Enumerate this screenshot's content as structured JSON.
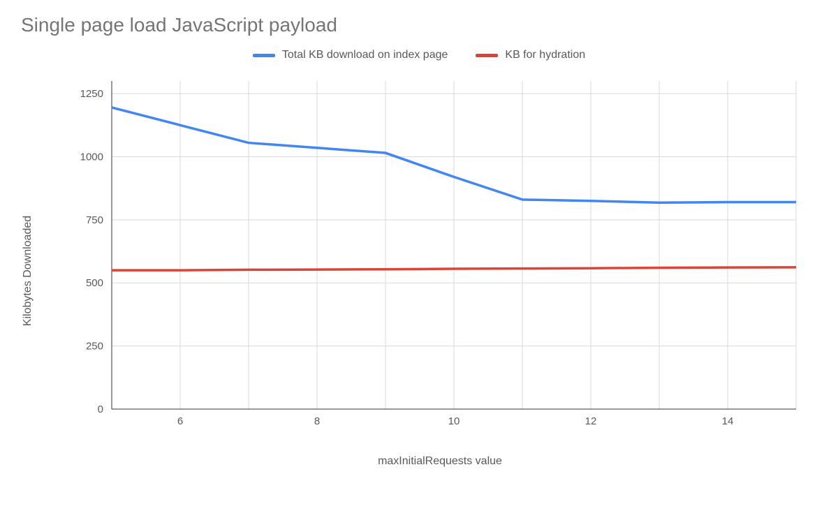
{
  "chart_data": {
    "type": "line",
    "title": "Single page load JavaScript payload",
    "xlabel": "maxInitialRequests value",
    "ylabel": "Kilobytes Downloaded",
    "x": [
      5,
      6,
      7,
      8,
      9,
      10,
      11,
      12,
      13,
      14,
      15
    ],
    "x_ticks": [
      6,
      8,
      10,
      12,
      14
    ],
    "y_ticks": [
      0,
      250,
      500,
      750,
      1000,
      1250
    ],
    "xlim": [
      5,
      15
    ],
    "ylim": [
      0,
      1300
    ],
    "legend_position": "top",
    "grid": true,
    "series": [
      {
        "name": "Total KB download on index page",
        "color": "#4285f4",
        "values": [
          1195,
          1125,
          1055,
          1035,
          1015,
          920,
          830,
          825,
          818,
          820,
          820
        ]
      },
      {
        "name": "KB for hydration",
        "color": "#db4437",
        "values": [
          550,
          550,
          552,
          553,
          554,
          556,
          557,
          558,
          560,
          561,
          562
        ]
      }
    ]
  }
}
